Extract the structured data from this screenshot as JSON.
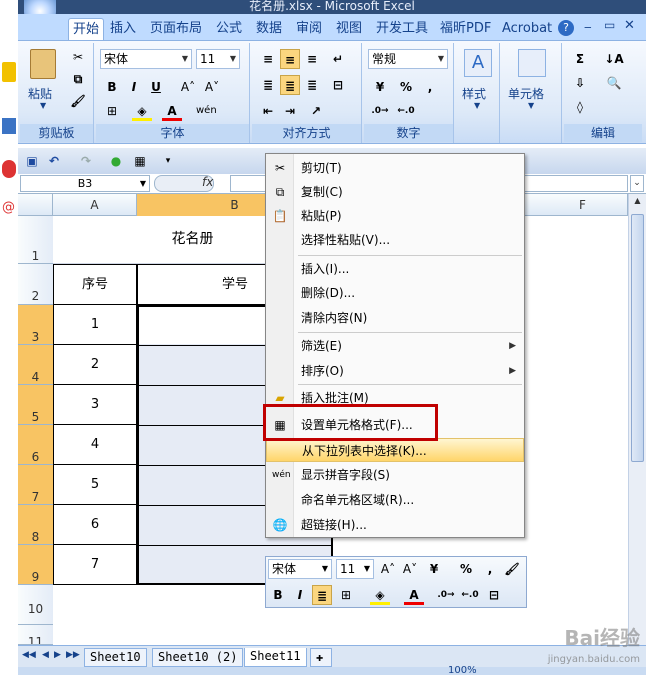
{
  "window": {
    "title": "花名册.xlsx - Microsoft Excel"
  },
  "ribbon_tabs": [
    "开始",
    "插入",
    "页面布局",
    "公式",
    "数据",
    "审阅",
    "视图",
    "开发工具",
    "福昕PDF",
    "Acrobat"
  ],
  "ribbon": {
    "clipboard": {
      "paste": "粘贴",
      "label": "剪贴板"
    },
    "font": {
      "name": "宋体",
      "size": "11",
      "bold": "B",
      "italic": "I",
      "underline": "U",
      "label": "字体"
    },
    "alignment": {
      "label": "对齐方式"
    },
    "number": {
      "format": "常规",
      "percent": "%",
      "comma": ",",
      "label": "数字"
    },
    "styles": {
      "label": "样式"
    },
    "cells": {
      "label": "单元格"
    },
    "editing": {
      "label": "编辑"
    }
  },
  "formula_bar": {
    "name_box": "B3",
    "fx": "fx"
  },
  "columns": [
    "A",
    "B",
    "F"
  ],
  "rows": [
    "1",
    "2",
    "3",
    "4",
    "5",
    "6",
    "7",
    "8",
    "9",
    "10",
    "11"
  ],
  "sheet": {
    "title": "花名册",
    "header_a": "序号",
    "header_b": "学号",
    "numbers": [
      "1",
      "2",
      "3",
      "4",
      "5",
      "6",
      "7"
    ]
  },
  "context_menu": [
    {
      "label": "剪切(T)"
    },
    {
      "label": "复制(C)"
    },
    {
      "label": "粘贴(P)"
    },
    {
      "label": "选择性粘贴(V)..."
    },
    {
      "label": "插入(I)..."
    },
    {
      "label": "删除(D)..."
    },
    {
      "label": "清除内容(N)"
    },
    {
      "label": "筛选(E)"
    },
    {
      "label": "排序(O)"
    },
    {
      "label": "插入批注(M)"
    },
    {
      "label": "设置单元格格式(F)..."
    },
    {
      "label": "从下拉列表中选择(K)..."
    },
    {
      "label": "显示拼音字段(S)"
    },
    {
      "label": "命名单元格区域(R)..."
    },
    {
      "label": "超链接(H)..."
    }
  ],
  "mini_toolbar": {
    "font": "宋体",
    "size": "11",
    "bold": "B",
    "italic": "I",
    "percent": "%",
    "comma": ","
  },
  "sheet_tabs": [
    "Sheet10",
    "Sheet10 (2)",
    "Sheet11"
  ],
  "status": {
    "zoom": "100%"
  },
  "watermark": {
    "brand": "Bai经验",
    "url": "jingyan.baidu.com"
  }
}
